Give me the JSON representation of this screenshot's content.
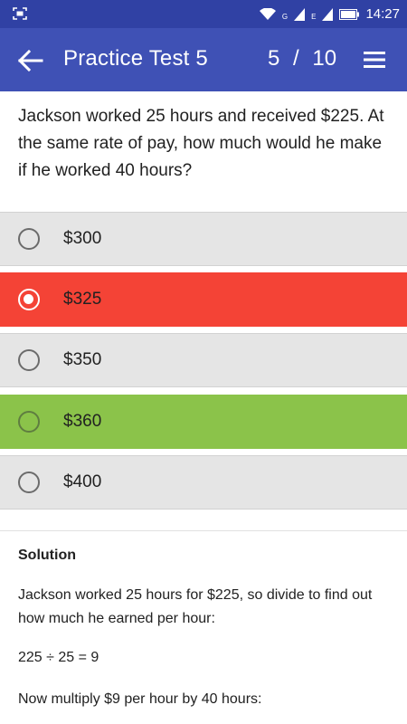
{
  "status_bar": {
    "time": "14:27",
    "network_g": "G",
    "network_e": "E",
    "icons": [
      "screen-capture-icon",
      "wifi-icon",
      "signal-icon",
      "battery-icon"
    ]
  },
  "app_bar": {
    "title": "Practice Test 5",
    "current": "5",
    "separator": "/",
    "total": "10",
    "icons": [
      "back-arrow-icon",
      "menu-icon"
    ]
  },
  "question": {
    "text": "Jackson worked 25 hours and received $225. At the same rate of pay, how much would he make if he worked 40 hours?"
  },
  "options": [
    {
      "label": "$300",
      "state": "normal"
    },
    {
      "label": "$325",
      "state": "selected-wrong"
    },
    {
      "label": "$350",
      "state": "normal"
    },
    {
      "label": "$360",
      "state": "correct"
    },
    {
      "label": "$400",
      "state": "normal"
    }
  ],
  "solution": {
    "title": "Solution",
    "lines": [
      "Jackson worked 25 hours for $225, so divide to find out how much he earned per hour:",
      "225 ÷ 25 = 9",
      "Now multiply $9 per hour by 40 hours:"
    ]
  },
  "colors": {
    "status_bar": "#3041a4",
    "app_bar": "#3f51b5",
    "wrong": "#f44336",
    "correct": "#8bc34a",
    "option_bg": "#e5e5e5"
  }
}
